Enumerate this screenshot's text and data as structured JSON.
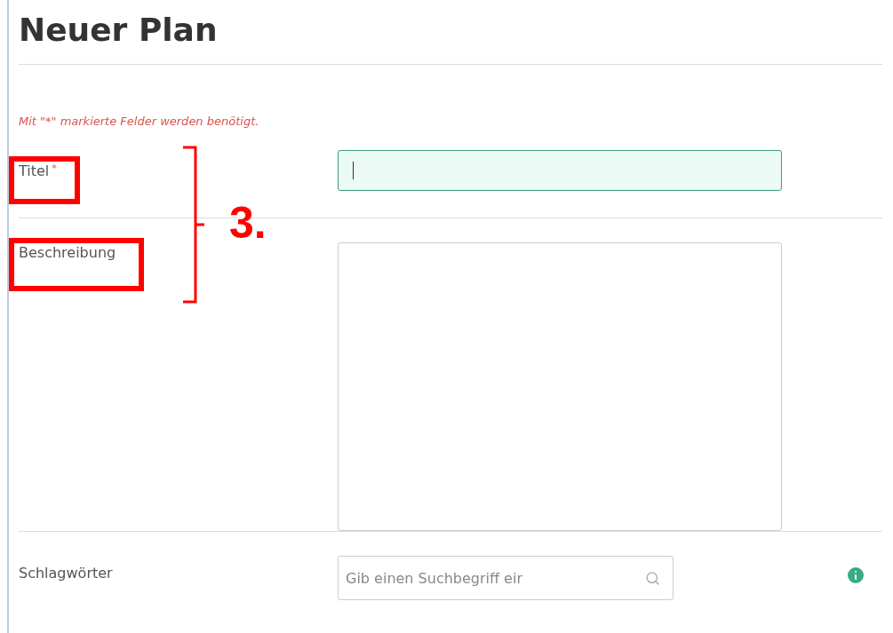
{
  "page_title": "Neuer Plan",
  "required_note": "Mit \"*\" markierte Felder werden benötigt.",
  "fields": [
    {
      "kind": "text",
      "label": "Titel",
      "required_mark": "*",
      "focused": true
    },
    {
      "kind": "textarea",
      "label": "Beschreibung",
      "focused": false
    },
    {
      "kind": "search",
      "label": "Schlagwörter",
      "placeholder": "Gib einen Suchbegriff eir",
      "focused": false
    }
  ],
  "annotation": {
    "label": "3."
  }
}
